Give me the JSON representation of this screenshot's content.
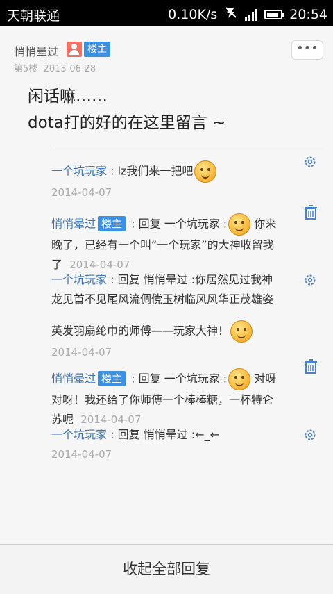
{
  "status_bar": {
    "carrier": "天朝联通",
    "speed": "0.10K/s",
    "time": "20:54",
    "battery_level": 0.9
  },
  "post": {
    "author": "悄悄晕过",
    "owner_badge": "楼主",
    "floor": "第5楼",
    "date": "2013-06-28",
    "more_label": "•••",
    "body_line1": "闲话嘛……",
    "body_line2": "dota打的好的在这里留言 ~"
  },
  "replies": [
    {
      "user": "一个坑玩家",
      "sep": " :",
      "text": " lz我们来一把吧",
      "time": "2014-04-07"
    },
    {
      "user": "悄悄晕过",
      "owner_badge": "楼主",
      "prefix": " : 回复 ",
      "target": "一个坑玩家",
      "sep": " :",
      "text_a": " 你来",
      "text_b": "晚了，已经有一个叫“一个玩家”的大神收留我",
      "text_c": "了",
      "time": "2014-04-07"
    },
    {
      "user": "一个坑玩家",
      "prefix": " : 回复 ",
      "target": "悄悄晕过",
      "sep": " :",
      "text_a": "你居然见过我神",
      "text_b": "龙见首不见尾风流倜傥玉树临风风华正茂雄姿",
      "text_c": "英发羽扇纶巾的师傅——玩家大神！",
      "time": "2014-04-07"
    },
    {
      "user": "悄悄晕过",
      "owner_badge": "楼主",
      "prefix": " : 回复 ",
      "target": "一个坑玩家",
      "sep": " :",
      "text_a": " 对呀",
      "text_b": "对呀！我还给了你师傅一个棒棒糖，一杯特仑",
      "text_c": "苏呢",
      "time": "2014-04-07"
    },
    {
      "user": "一个坑玩家",
      "prefix": " : 回复 ",
      "target": "悄悄晕过",
      "sep": " :",
      "text": "←_←",
      "time": "2014-04-07"
    }
  ],
  "collapse_label": "收起全部回复",
  "colors": {
    "link": "#3b74b6",
    "badge": "#3d8fe0",
    "avatar": "#f07064"
  }
}
